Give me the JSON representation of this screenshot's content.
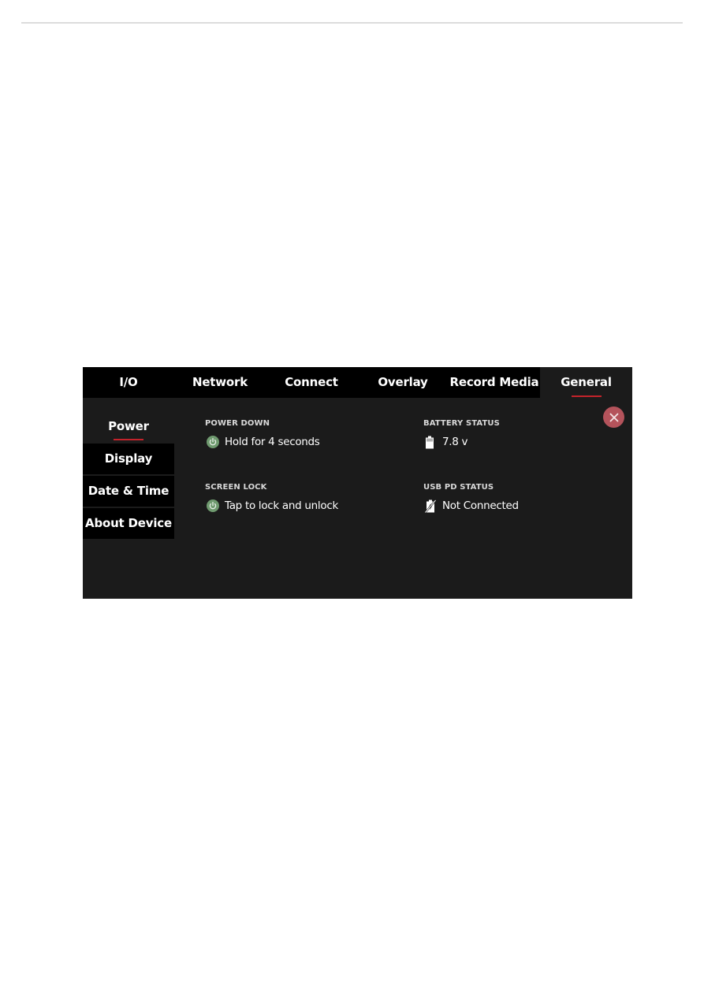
{
  "tabs": [
    {
      "label": "I/O",
      "active": false
    },
    {
      "label": "Network",
      "active": false
    },
    {
      "label": "Connect",
      "active": false
    },
    {
      "label": "Overlay",
      "active": false
    },
    {
      "label": "Record Media",
      "active": false
    },
    {
      "label": "General",
      "active": true
    }
  ],
  "sidebar": {
    "items": [
      {
        "label": "Power",
        "active": true
      },
      {
        "label": "Display",
        "active": false
      },
      {
        "label": "Date & Time",
        "active": false
      },
      {
        "label": "About Device",
        "active": false
      }
    ]
  },
  "power": {
    "power_down": {
      "label": "POWER DOWN",
      "value": "Hold for 4 seconds",
      "icon": "power-icon"
    },
    "screen_lock": {
      "label": "SCREEN LOCK",
      "value": "Tap to lock and unlock",
      "icon": "power-icon"
    },
    "battery_status": {
      "label": "BATTERY STATUS",
      "value": "7.8 v",
      "icon": "battery-icon"
    },
    "usb_pd_status": {
      "label": "USB PD STATUS",
      "value": "Not Connected",
      "icon": "usb-power-disconnected-icon"
    }
  },
  "close": {
    "icon": "close-icon"
  },
  "colors": {
    "accent": "#c4232b",
    "close_button": "#b4535b",
    "power_icon": "#6f9a6f",
    "panel_bg": "#1b1b1b",
    "bar_bg": "#000000"
  }
}
